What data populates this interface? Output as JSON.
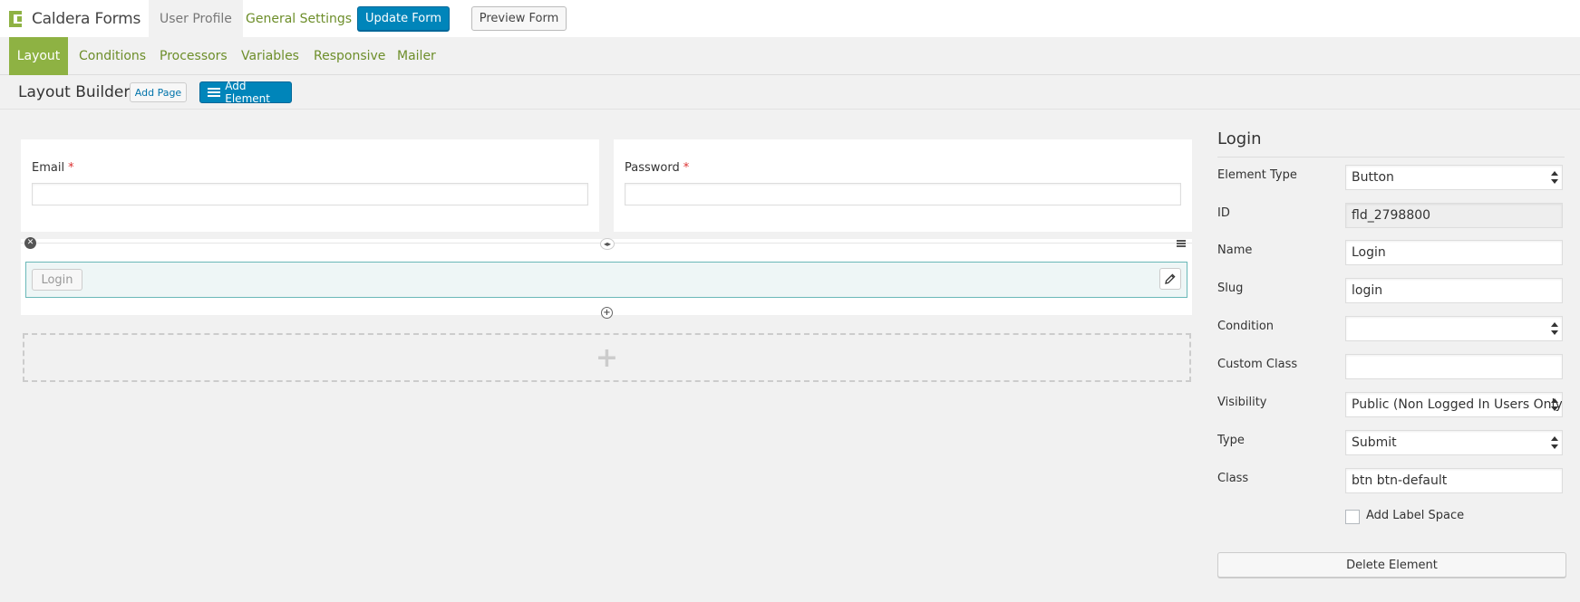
{
  "brand": {
    "name": "Caldera Forms"
  },
  "top_tabs": [
    {
      "label": "User Profile",
      "active": true
    },
    {
      "label": "General Settings",
      "active": false
    }
  ],
  "top_actions": {
    "update_label": "Update Form",
    "preview_label": "Preview Form"
  },
  "subnav": [
    {
      "label": "Layout",
      "active": true
    },
    {
      "label": "Conditions"
    },
    {
      "label": "Processors"
    },
    {
      "label": "Variables"
    },
    {
      "label": "Responsive"
    },
    {
      "label": "Mailer"
    }
  ],
  "builder": {
    "title": "Layout Builder",
    "add_page_label": "Add Page",
    "add_element_label": "Add Element"
  },
  "fields": {
    "email": {
      "label": "Email",
      "required_mark": "*"
    },
    "password": {
      "label": "Password",
      "required_mark": "*"
    }
  },
  "row": {
    "login_button_label": "Login",
    "add_row_glyph": "+"
  },
  "panel": {
    "title": "Login",
    "element_type": {
      "label": "Element Type",
      "value": "Button"
    },
    "id": {
      "label": "ID",
      "value": "fld_2798800"
    },
    "name": {
      "label": "Name",
      "value": "Login"
    },
    "slug": {
      "label": "Slug",
      "value": "login"
    },
    "condition": {
      "label": "Condition",
      "value": ""
    },
    "custom_class": {
      "label": "Custom Class",
      "value": ""
    },
    "visibility": {
      "label": "Visibility",
      "value": "Public (Non Logged In Users Only)"
    },
    "type": {
      "label": "Type",
      "value": "Submit"
    },
    "class": {
      "label": "Class",
      "value": "btn btn-default"
    },
    "add_label_space": {
      "label": "Add Label Space",
      "checked": false
    },
    "delete_label": "Delete Element"
  },
  "colors": {
    "accent_green": "#8eb243",
    "link_green": "#6d8e2a",
    "primary_blue": "#0085ba",
    "required_red": "#dc3232"
  }
}
